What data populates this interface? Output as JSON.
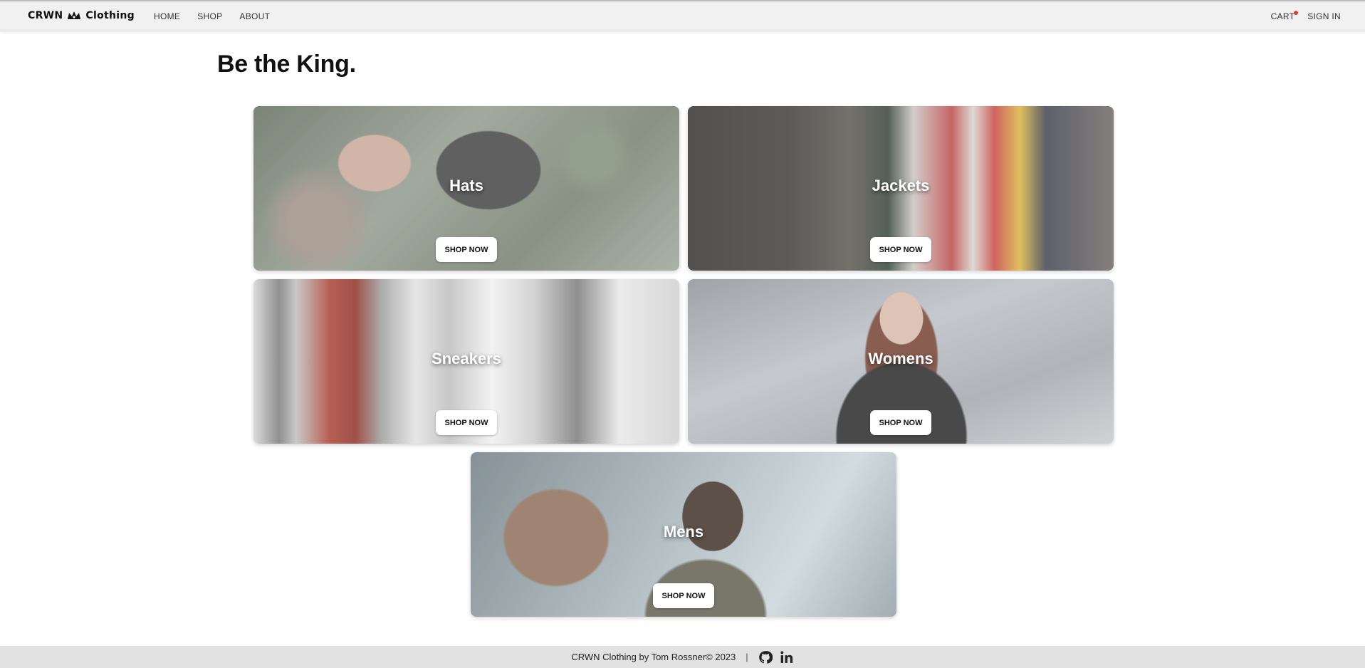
{
  "header": {
    "brand_left": "CRWN",
    "brand_right": "Clothing",
    "nav": {
      "home": "HOME",
      "shop": "SHOP",
      "about": "ABOUT"
    },
    "cart_label": "CART",
    "cart_has_items": true,
    "sign_in_label": "SIGN IN"
  },
  "page": {
    "title": "Be the King."
  },
  "categories": [
    {
      "title": "Hats",
      "button": "SHOP NOW"
    },
    {
      "title": "Jackets",
      "button": "SHOP NOW"
    },
    {
      "title": "Sneakers",
      "button": "SHOP NOW"
    },
    {
      "title": "Womens",
      "button": "SHOP NOW"
    },
    {
      "title": "Mens",
      "button": "SHOP NOW"
    }
  ],
  "footer": {
    "text": "CRWN Clothing by Tom Rossner© 2023",
    "separator": "|",
    "icons": [
      "github-icon",
      "linkedin-icon"
    ]
  },
  "colors": {
    "header_bg": "#f1f1f1",
    "cart_dot": "#e0452f",
    "footer_bg": "#e2e2e2"
  }
}
